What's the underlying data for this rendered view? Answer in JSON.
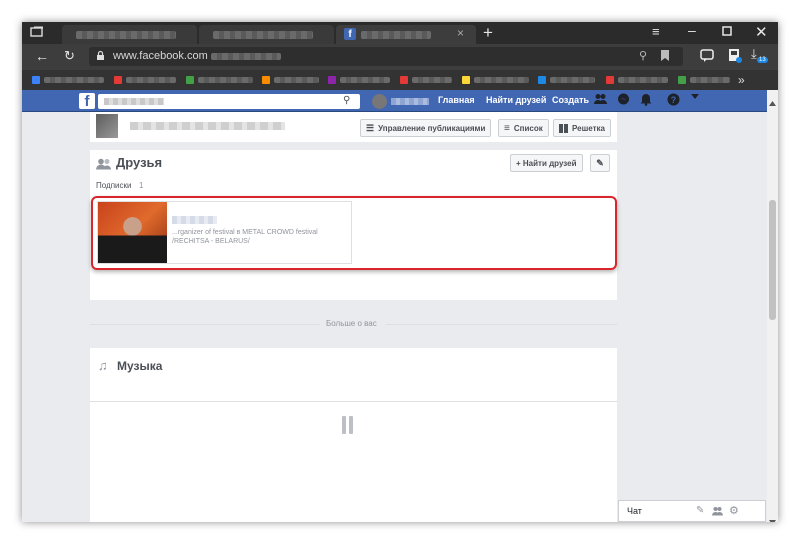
{
  "browser": {
    "url": "www.facebook.com",
    "bookmarks_more": "»",
    "downloads_count": "13"
  },
  "facebook": {
    "nav": {
      "home": "Главная",
      "find_friends": "Найти друзей",
      "create": "Создать"
    },
    "timeline_controls": {
      "manage_posts": "Управление публикациями",
      "list_view": "Список",
      "grid_view": "Решетка"
    },
    "friends": {
      "title": "Друзья",
      "find_friends_button": "+ Найти друзей",
      "subscriptions_label": "Подписки",
      "subscriptions_count": "1",
      "card_line1": "...rganizer of festival в METAL CROWD festival",
      "card_line2": "/RECHITSA - BELARUS/"
    },
    "more_about_you": "Больше о вас",
    "music": {
      "title": "Музыка"
    },
    "chat": {
      "label": "Чат"
    }
  },
  "colors": {
    "fb_blue": "#4267b2",
    "highlight_red": "#d9262d"
  }
}
